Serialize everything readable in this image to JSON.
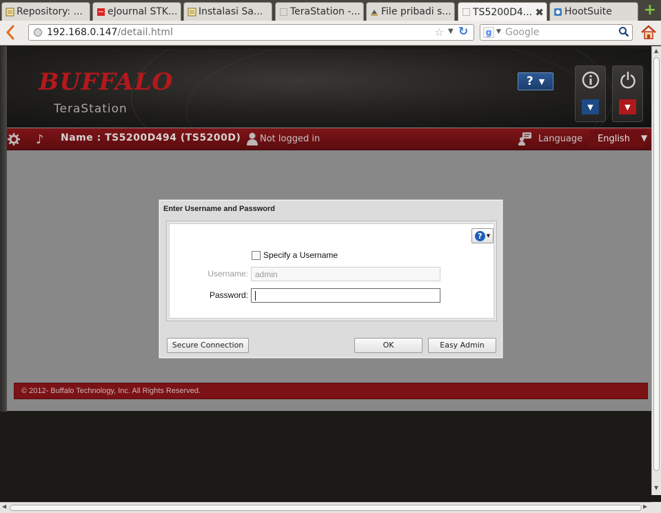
{
  "browser": {
    "tabs": [
      {
        "title": "Repository: ...",
        "icon": "page-icon"
      },
      {
        "title": "eJournal STK...",
        "icon": "page-icon"
      },
      {
        "title": "Instalasi Sa...",
        "icon": "page-icon"
      },
      {
        "title": "TeraStation -...",
        "icon": "blank-page-icon"
      },
      {
        "title": "File pribadi s...",
        "icon": "page-icon"
      },
      {
        "title": "TS5200D4...",
        "icon": "blank-page-icon",
        "active": true
      },
      {
        "title": "HootSuite",
        "icon": "page-icon"
      }
    ],
    "url_host": "192.168.0.147",
    "url_path": "/detail.html",
    "search_placeholder": "Google"
  },
  "app": {
    "logo": "BUFFALO",
    "product": "TeraStation",
    "help_label": "?",
    "device_name": "Name : TS5200D494 (TS5200D)",
    "login_status": "Not logged in",
    "language_label": "Language",
    "language_value": "English"
  },
  "dialog": {
    "title": "Enter Username and Password",
    "specify_username": "Specify a Username",
    "username_label": "Username:",
    "username_value": "admin",
    "password_label": "Password:",
    "password_value": "",
    "secure_connection": "Secure Connection",
    "ok": "OK",
    "easy_admin": "Easy Admin"
  },
  "footer": {
    "copyright": "© 2012- Buffalo Technology, Inc. All Rights Reserved."
  },
  "colors": {
    "brand_red": "#b3191c",
    "bar_red": "#7e1418",
    "help_blue": "#1e4a86"
  }
}
